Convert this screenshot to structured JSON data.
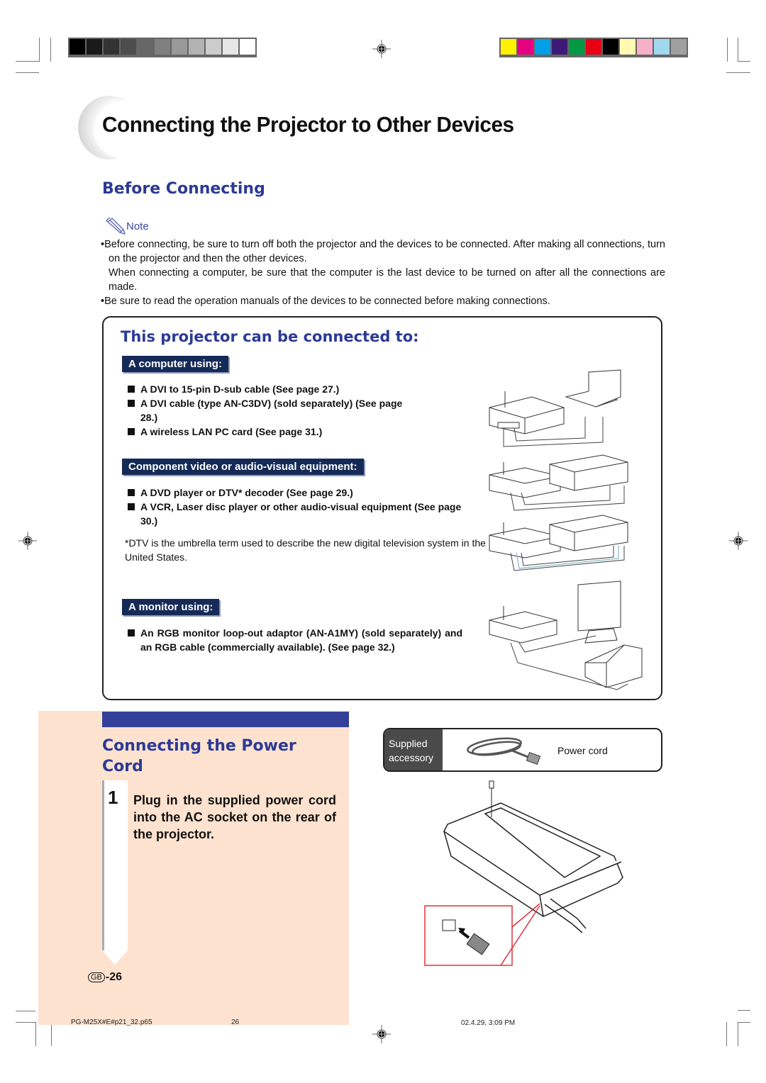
{
  "print_marks": {
    "grayscale_bar": [
      "#000000",
      "#1a1a1a",
      "#333333",
      "#4d4d4d",
      "#666666",
      "#808080",
      "#999999",
      "#b3b3b3",
      "#cccccc",
      "#e6e6e6",
      "#ffffff"
    ],
    "color_bar": [
      "#fff200",
      "#e4007f",
      "#00a0e9",
      "#3e1a78",
      "#009944",
      "#e60012",
      "#000000",
      "#fff9b1",
      "#f8b0c8",
      "#a0d8ef",
      "#a0a0a0"
    ]
  },
  "page": {
    "title": "Connecting the Projector to Other Devices",
    "before_connecting": {
      "heading": "Before Connecting",
      "note_label": "Note",
      "notes": [
        "•Before connecting, be sure to turn off both the projector and the devices to be connected. After making all connections, turn on the projector and then the other devices.",
        "When connecting a computer, be sure that the computer is the last device to be turned on after all the connections are made.",
        "•Be sure to read the operation manuals of the devices to be connected before making connections."
      ]
    },
    "connect_box": {
      "heading": "This projector can be connected to:",
      "sections": [
        {
          "tag": "A computer using:",
          "items": [
            "A DVI to 15-pin D-sub cable (See page 27.)",
            "A DVI cable (type AN-C3DV) (sold separately) (See page 28.)",
            "A wireless LAN PC card (See page 31.)"
          ]
        },
        {
          "tag": "Component video or audio-visual equipment:",
          "items": [
            "A DVD player or DTV* decoder (See page 29.)",
            "A VCR, Laser disc player or other audio-visual equipment (See page 30.)"
          ],
          "footnote": "*DTV is the umbrella term used to describe the new digital television system in the United States."
        },
        {
          "tag": "A monitor using:",
          "items": [
            "An RGB monitor loop-out adaptor (AN-A1MY) (sold separately) and an RGB cable (commercially available). (See page 32.)"
          ]
        }
      ]
    },
    "power": {
      "heading_line1": "Connecting the Power",
      "heading_line2": "Cord",
      "step_number": "1",
      "step_text": "Plug in the supplied power cord into the AC socket on the rear of the projector.",
      "accessory_label_line1": "Supplied",
      "accessory_label_line2": "accessory",
      "accessory_name": "Power cord"
    },
    "page_number_badge": "GB",
    "page_number": "-26"
  },
  "footer": {
    "file": "PG-M25X#E#p21_32.p65",
    "page": "26",
    "timestamp": "02.4.29, 3:09 PM"
  },
  "colors": {
    "heading_blue": "#2c3a96",
    "tag_navy": "#162a58",
    "peach": "#fde3cf",
    "callout_red": "#e0303c"
  }
}
